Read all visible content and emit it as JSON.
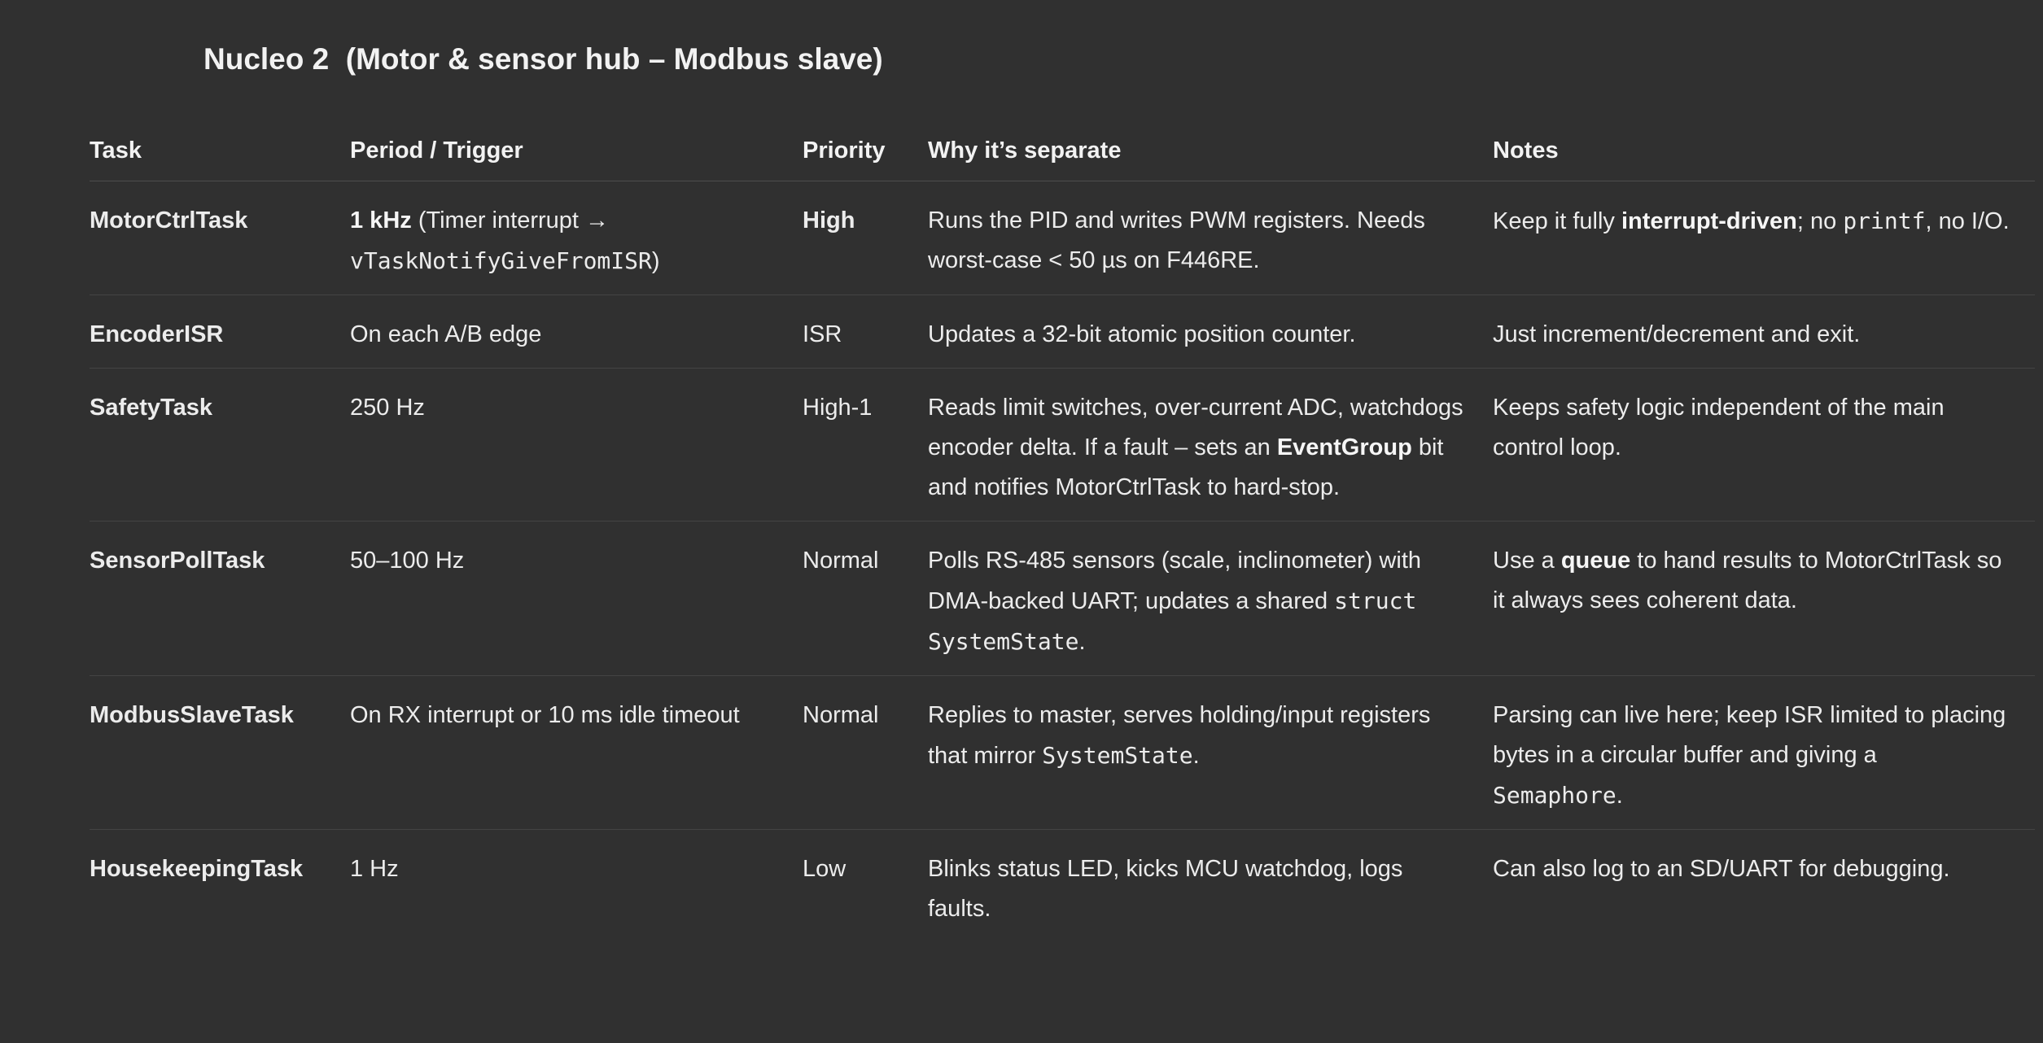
{
  "heading": "Nucleo 2  (Motor & sensor hub – Modbus slave)",
  "columns": {
    "task": "Task",
    "period": "Period / Trigger",
    "priority": "Priority",
    "why": "Why it’s separate",
    "notes": "Notes"
  },
  "rows": [
    {
      "task": "MotorCtrlTask",
      "period": {
        "bold": "1 kHz",
        "text": " (Timer interrupt → ",
        "code": "vTaskNotifyGiveFromISR",
        "end": ")"
      },
      "priority": "High",
      "why": "Runs the PID and writes PWM registers. Needs worst-case < 50 µs on F446RE.",
      "notes": {
        "pre": "Keep it fully ",
        "bold": "interrupt-driven",
        "mid": "; no ",
        "code": "printf",
        "end": ", no I/O."
      }
    },
    {
      "task": "EncoderISR",
      "period": "On each A/B edge",
      "priority": "ISR",
      "why": "Updates a 32-bit atomic position counter.",
      "notes": "Just increment/decrement and exit."
    },
    {
      "task": "SafetyTask",
      "period": "250 Hz",
      "priority": "High-1",
      "why": {
        "pre": "Reads limit switches, over-current ADC, watchdogs encoder delta. If a fault – sets an ",
        "bold": "EventGroup",
        "end": " bit and notifies MotorCtrlTask to hard-stop."
      },
      "notes": "Keeps safety logic independent of the main control loop."
    },
    {
      "task": "SensorPollTask",
      "period": "50–100 Hz",
      "priority": "Normal",
      "why": {
        "pre": "Polls RS-485 sensors (scale, inclinometer) with DMA-backed UART; updates a shared ",
        "code": "struct SystemState",
        "end": "."
      },
      "notes": {
        "pre": "Use a ",
        "bold": "queue",
        "end": " to hand results to MotorCtrlTask so it always sees coherent data."
      }
    },
    {
      "task": "ModbusSlaveTask",
      "period": "On RX interrupt or 10 ms idle timeout",
      "priority": "Normal",
      "why": {
        "pre": "Replies to master, serves holding/input registers that mirror ",
        "code": "SystemState",
        "end": "."
      },
      "notes": {
        "pre": "Parsing can live here; keep ISR limited to placing bytes in a circular buffer and giving a ",
        "code": "Semaphore",
        "end": "."
      }
    },
    {
      "task": "HousekeepingTask",
      "period": "1 Hz",
      "priority": "Low",
      "why": "Blinks status LED, kicks MCU watchdog, logs faults.",
      "notes": "Can also log to an SD/UART for debugging."
    }
  ]
}
